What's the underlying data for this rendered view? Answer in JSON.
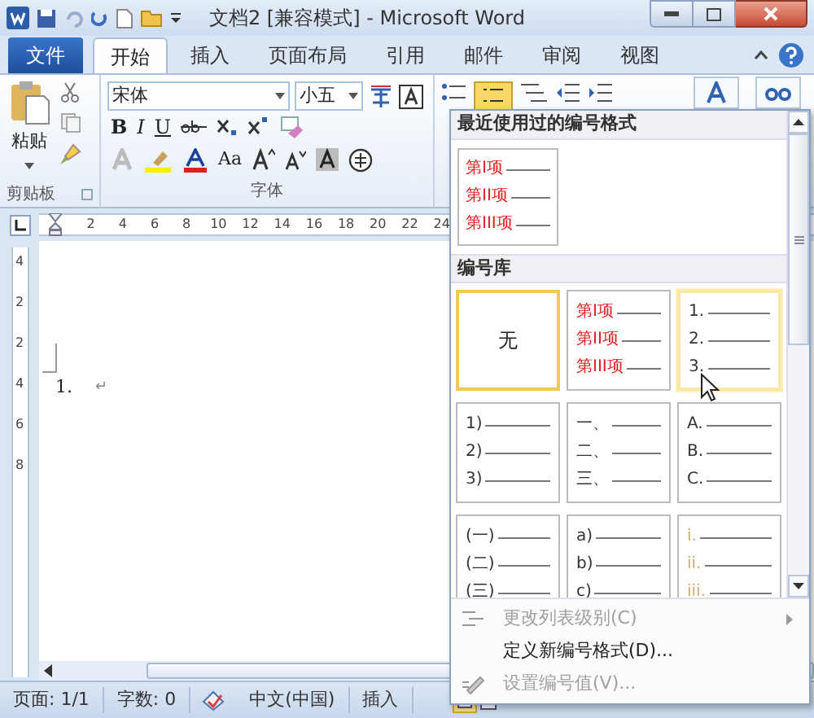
{
  "title_bar": {
    "title": "文档2 [兼容模式] - Microsoft Word"
  },
  "tabs": [
    {
      "label": "文件",
      "kind": "file",
      "selected": false
    },
    {
      "label": "开始",
      "kind": "tab",
      "selected": true
    },
    {
      "label": "插入",
      "kind": "tab",
      "selected": false
    },
    {
      "label": "页面布局",
      "kind": "tab",
      "selected": false
    },
    {
      "label": "引用",
      "kind": "tab",
      "selected": false
    },
    {
      "label": "邮件",
      "kind": "tab",
      "selected": false
    },
    {
      "label": "审阅",
      "kind": "tab",
      "selected": false
    },
    {
      "label": "视图",
      "kind": "tab",
      "selected": false
    }
  ],
  "ribbon": {
    "clipboard": {
      "paste_label": "粘贴",
      "group_label": "剪贴板"
    },
    "font": {
      "font_name": "宋体",
      "font_size": "小五",
      "group_label": "字体",
      "format_buttons": [
        "B",
        "I",
        "U"
      ],
      "case_button": "Aa"
    }
  },
  "ruler": {
    "h_ticks": [
      "2",
      "4",
      "6",
      "8",
      "10",
      "12",
      "14",
      "16",
      "18",
      "20",
      "22",
      "24"
    ],
    "v_ticks": [
      "4",
      "2",
      "2",
      "4",
      "6",
      "8"
    ]
  },
  "document": {
    "list_number": "1.",
    "paragraph_mark": "↵"
  },
  "numbering_menu": {
    "recent_header": "最近使用过的编号格式",
    "recent": [
      {
        "lines": [
          "第I项",
          "第II项",
          "第III项"
        ],
        "color": "#e02020"
      }
    ],
    "library_header": "编号库",
    "library": [
      {
        "kind": "none",
        "label": "无",
        "selected": true,
        "hovered": false,
        "color": "#222222"
      },
      {
        "kind": "list",
        "lines": [
          "第I项",
          "第II项",
          "第III项"
        ],
        "selected": false,
        "hovered": false,
        "color": "#e02020"
      },
      {
        "kind": "list",
        "lines": [
          "1.",
          "2.",
          "3."
        ],
        "selected": false,
        "hovered": true,
        "color": "#333333"
      },
      {
        "kind": "list",
        "lines": [
          "1)",
          "2)",
          "3)"
        ],
        "selected": false,
        "hovered": false,
        "color": "#333333"
      },
      {
        "kind": "list",
        "lines": [
          "一、",
          "二、",
          "三、"
        ],
        "selected": false,
        "hovered": false,
        "color": "#333333"
      },
      {
        "kind": "list",
        "lines": [
          "A.",
          "B.",
          "C."
        ],
        "selected": false,
        "hovered": false,
        "color": "#333333"
      },
      {
        "kind": "list",
        "lines": [
          "(一)",
          "(二)",
          "(三)"
        ],
        "selected": false,
        "hovered": false,
        "color": "#333333"
      },
      {
        "kind": "list",
        "lines": [
          "a)",
          "b)",
          "c)"
        ],
        "selected": false,
        "hovered": false,
        "color": "#333333"
      },
      {
        "kind": "list",
        "lines": [
          "i.",
          "ii.",
          "iii."
        ],
        "selected": false,
        "hovered": false,
        "color": "#c8b070"
      }
    ],
    "items": [
      {
        "label": "更改列表级别(C)",
        "disabled": true,
        "submenu": true
      },
      {
        "label": "定义新编号格式(D)...",
        "disabled": false,
        "submenu": false
      },
      {
        "label": "设置编号值(V)...",
        "disabled": true,
        "submenu": false
      }
    ]
  },
  "status_bar": {
    "page": "页面: 1/1",
    "words": "字数: 0",
    "language": "中文(中国)",
    "mode": "插入"
  }
}
